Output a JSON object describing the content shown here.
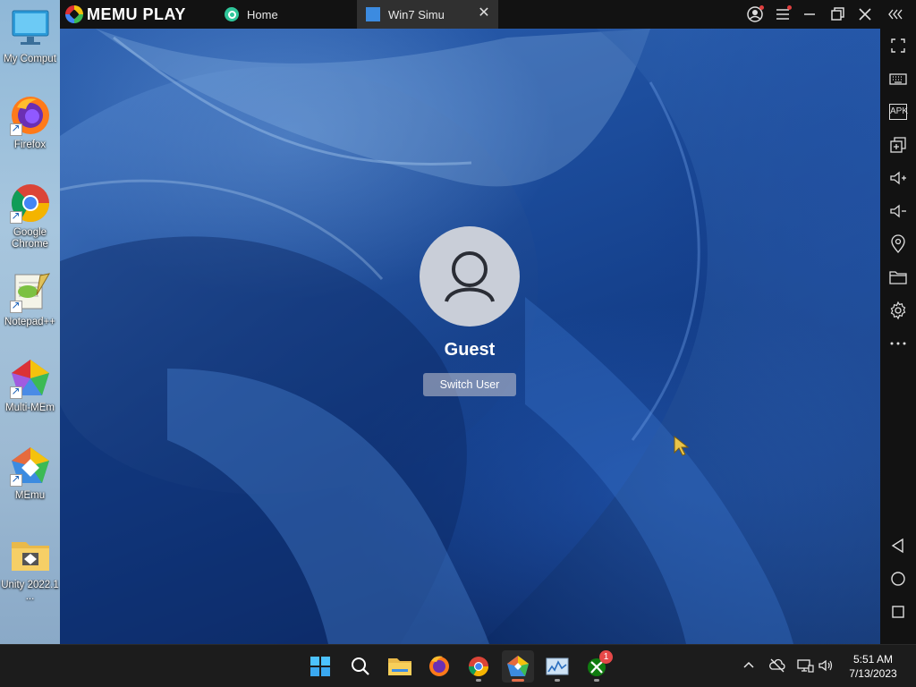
{
  "desktop": {
    "icons": [
      {
        "label": "My Comput",
        "icon": "computer-icon"
      },
      {
        "label": "Firefox",
        "icon": "firefox-icon"
      },
      {
        "label": "Google Chrome",
        "icon": "chrome-icon"
      },
      {
        "label": "Notepad++",
        "icon": "notepad-plus-plus-icon"
      },
      {
        "label": "Multi-MEm",
        "icon": "multi-memu-icon"
      },
      {
        "label": "MEmu",
        "icon": "memu-icon"
      },
      {
        "label": "Unity 2022.1 ...",
        "icon": "folder-icon"
      }
    ]
  },
  "memu": {
    "logo_text": "MEMU PLAY",
    "tabs": [
      {
        "label": "Home",
        "icon": "home-app-icon"
      },
      {
        "label": "Win7 Simu",
        "icon": "win7-simu-icon"
      }
    ],
    "titlebar_buttons": [
      "account-icon",
      "menu-icon",
      "minimize-icon",
      "restore-icon",
      "close-icon",
      "collapse-sidebar-icon"
    ],
    "sidebar_buttons": [
      "fullscreen-icon",
      "keyboard-icon",
      "apk-icon",
      "multi-window-icon",
      "volume-up-icon",
      "volume-down-icon",
      "location-icon",
      "folder-icon",
      "settings-icon",
      "more-icon",
      "back-icon",
      "home-icon",
      "recents-icon"
    ],
    "apk_label": "APK"
  },
  "lockscreen": {
    "username": "Guest",
    "switch_user_label": "Switch User"
  },
  "taskbar": {
    "apps": [
      "start-icon",
      "search-icon",
      "file-explorer-icon",
      "firefox-icon",
      "chrome-icon",
      "memu-icon",
      "task-manager-icon",
      "xbox-icon"
    ],
    "xbox_badge": "1",
    "time": "5:51 AM",
    "date": "7/13/2023"
  },
  "colors": {
    "accent": "#e46d4a",
    "wallpaper": "#1d4e9e",
    "titlebar": "#121212"
  }
}
